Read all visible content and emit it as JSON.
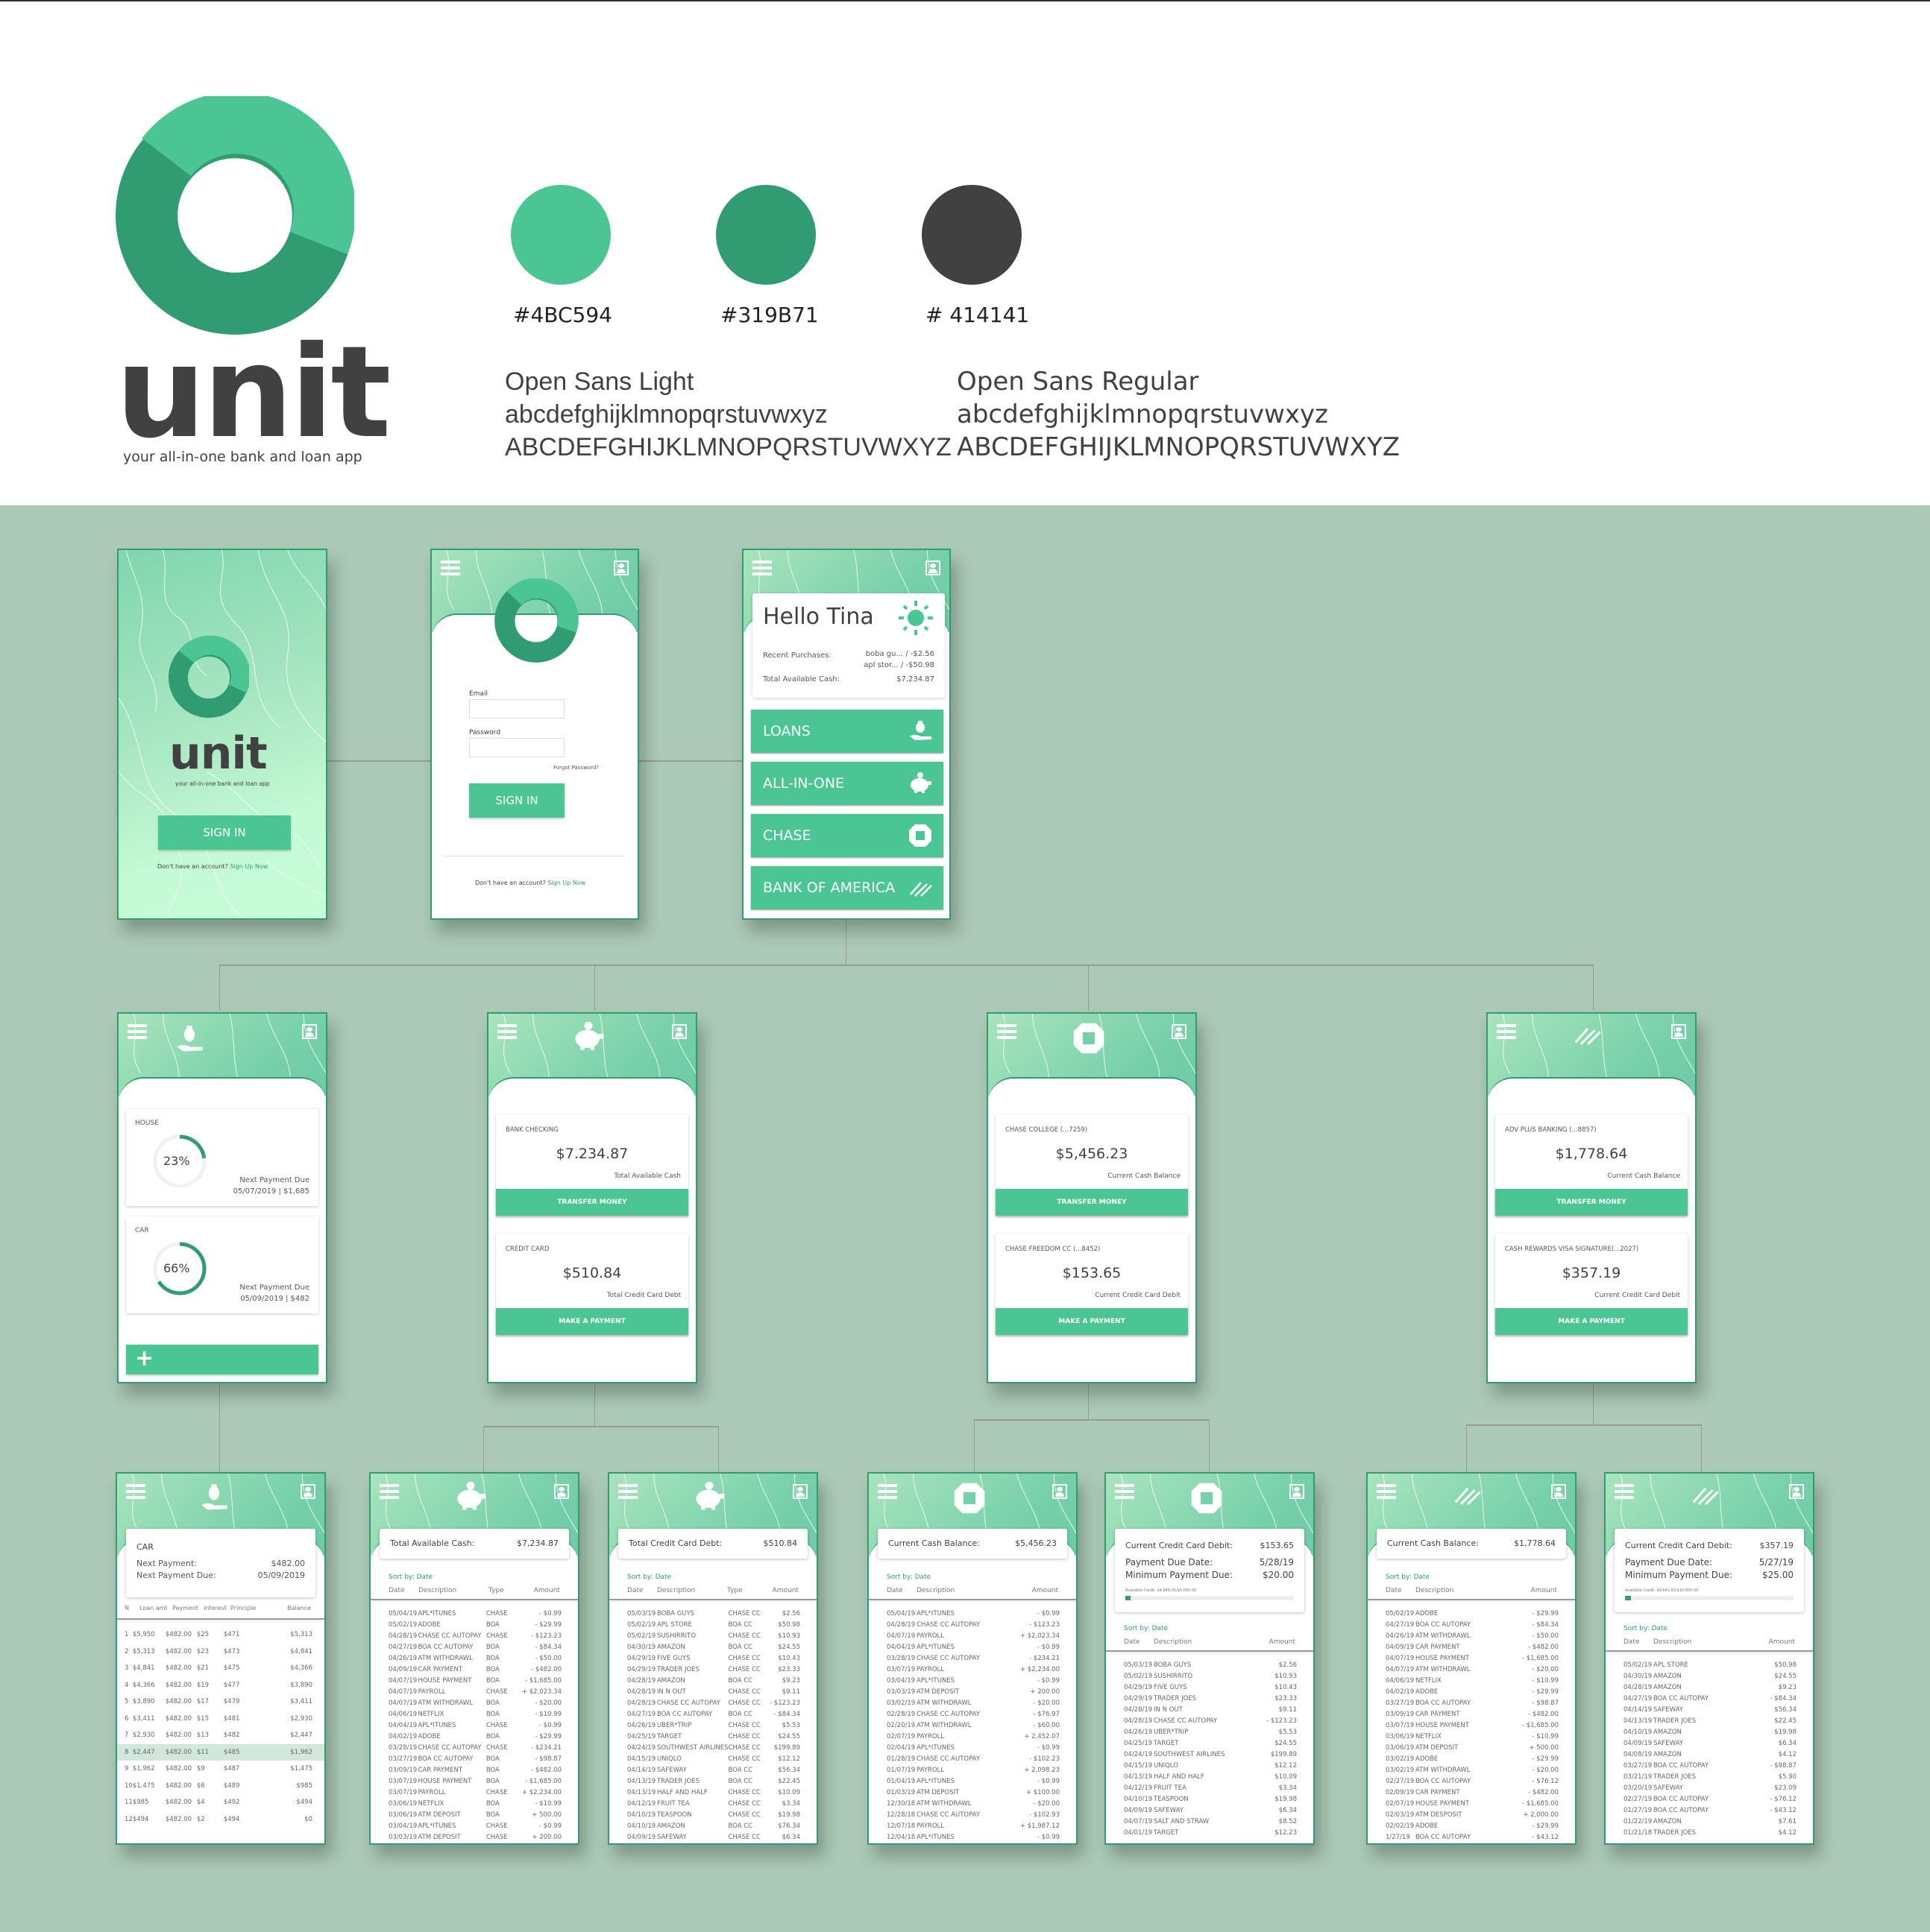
{
  "brand": {
    "wordmark": "unit",
    "tagline": "your all-in-one bank and loan app",
    "colors": [
      {
        "hex": "#4BC594",
        "label": "#4BC594"
      },
      {
        "hex": "#319B71",
        "label": "#319B71"
      },
      {
        "hex": "#414141",
        "label": "# 414141"
      }
    ],
    "fonts": [
      {
        "name": "Open Sans Light",
        "lower": "abcdefghijklmnopqrstuvwxyz",
        "upper": "ABCDEFGHIJKLMNOPQRSTUVWXYZ"
      },
      {
        "name": "Open Sans Regular",
        "lower": "abcdefghijklmnopqrstuvwxyz",
        "upper": "ABCDEFGHIJKLMNOPQRSTUVWXYZ"
      }
    ]
  },
  "splash": {
    "wordmark": "unit",
    "tagline": "your all-in-one bank and loan app",
    "sign_in": "SIGN IN",
    "no_account": "Don't have an account?",
    "sign_up": "Sign Up Now"
  },
  "login": {
    "email_label": "Email",
    "email_value": "",
    "password_label": "Password",
    "password_value": "",
    "forgot": "Forgot Password?",
    "sign_in": "SIGN IN",
    "no_account": "Don't have an account?",
    "sign_up": "Sign Up Now"
  },
  "home": {
    "greeting": "Hello Tina",
    "recent_label": "Recent Purchases:",
    "recent": [
      "boba gu... / -$2.56",
      "apl stor... / -$50.98"
    ],
    "cash_label": "Total Available Cash:",
    "cash_value": "$7,234.87",
    "buttons": [
      "LOANS",
      "ALL-IN-ONE",
      "CHASE",
      "BANK OF AMERICA"
    ]
  },
  "loans": {
    "items": [
      {
        "name": "HOUSE",
        "percent": 23,
        "percent_label": "23%",
        "next_label": "Next Payment Due",
        "next_value": "05/07/2019 | $1,685"
      },
      {
        "name": "CAR",
        "percent": 66,
        "percent_label": "66%",
        "next_label": "Next Payment Due",
        "next_value": "05/09/2019 | $482"
      }
    ],
    "add_label": "+"
  },
  "all_in_one": {
    "accounts": [
      {
        "name": "BANK CHECKING",
        "amount": "$7.234.87",
        "caption": "Total Available Cash",
        "action": "TRANSFER MONEY"
      },
      {
        "name": "CREDIT CARD",
        "amount": "$510.84",
        "caption": "Total Credit Card Debt",
        "action": "MAKE A PAYMENT"
      }
    ]
  },
  "chase": {
    "accounts": [
      {
        "name": "CHASE COLLEGE (...7259)",
        "amount": "$5,456.23",
        "caption": "Current Cash Balance",
        "action": "TRANSFER MONEY"
      },
      {
        "name": "CHASE FREEDOM CC (...8452)",
        "amount": "$153.65",
        "caption": "Current Credit Card Debit",
        "action": "MAKE A PAYMENT"
      }
    ]
  },
  "boa": {
    "accounts": [
      {
        "name": "ADV PLUS BANKING (...8857)",
        "amount": "$1,778.64",
        "caption": "Current Cash Balance",
        "action": "TRANSFER MONEY"
      },
      {
        "name": "CASH REWARDS VISA SIGNATURE(...2027)",
        "amount": "$357.19",
        "caption": "Current Credit Card Debit",
        "action": "MAKE A PAYMENT"
      }
    ]
  },
  "car_loan": {
    "title": "CAR",
    "next_payment_label": "Next Payment:",
    "next_payment_value": "$482.00",
    "next_due_label": "Next Payment Due:",
    "next_due_value": "05/09/2019",
    "columns": [
      "N",
      "Loan amt",
      "Payment",
      "Interest",
      "Principle",
      "Balance"
    ],
    "highlighted_row": 8,
    "rows": [
      [
        "1",
        "$5,950",
        "$482.00",
        "$25",
        "$471",
        "$5,313"
      ],
      [
        "2",
        "$5,313",
        "$482.00",
        "$23",
        "$473",
        "$4,841"
      ],
      [
        "3",
        "$4,841",
        "$482.00",
        "$21",
        "$475",
        "$4,366"
      ],
      [
        "4",
        "$4,366",
        "$482.00",
        "$19",
        "$477",
        "$3,890"
      ],
      [
        "5",
        "$3,890",
        "$482.00",
        "$17",
        "$479",
        "$3,411"
      ],
      [
        "6",
        "$3,411",
        "$482.00",
        "$15",
        "$481",
        "$2,930"
      ],
      [
        "7",
        "$2,930",
        "$482.00",
        "$13",
        "$482",
        "$2,447"
      ],
      [
        "8",
        "$2,447",
        "$482.00",
        "$11",
        "$485",
        "$1,962"
      ],
      [
        "9",
        "$1,962",
        "$482.00",
        "$9",
        "$487",
        "$1,475"
      ],
      [
        "10",
        "$1,475",
        "$482.00",
        "$6",
        "$489",
        "$985"
      ],
      [
        "11",
        "$985",
        "$482.00",
        "$4",
        "$492",
        "$494"
      ],
      [
        "12",
        "$494",
        "$482.00",
        "$2",
        "$494",
        "$0"
      ]
    ]
  },
  "ledgers": [
    {
      "id": "aio-cash",
      "summary": [
        [
          "Total Available Cash:",
          "$7,234.87"
        ]
      ],
      "sort": "Sort by: Date",
      "columns": [
        "Date",
        "Description",
        "Type",
        "Amount"
      ],
      "rows": [
        [
          "05/04/19",
          "APL*ITUNES",
          "CHASE",
          "- $0.99"
        ],
        [
          "05/02/19",
          "ADOBE",
          "BOA",
          "- $29.99"
        ],
        [
          "04/28/19",
          "CHASE CC AUTOPAY",
          "CHASE",
          "- $123.23"
        ],
        [
          "04/27/19",
          "BOA CC AUTOPAY",
          "BOA",
          "- $84.34"
        ],
        [
          "04/26/19",
          "ATM WITHDRAWL",
          "BOA",
          "- $50.00"
        ],
        [
          "04/09/19",
          "CAR PAYMENT",
          "BOA",
          "- $482.00"
        ],
        [
          "04/07/19",
          "HOUSE PAYMENT",
          "BOA",
          "- $1,685.00"
        ],
        [
          "04/07/19",
          "PAYROLL",
          "CHASE",
          "+ $2,023.34"
        ],
        [
          "04/07/19",
          "ATM WITHDRAWL",
          "BOA",
          "- $20.00"
        ],
        [
          "04/06/19",
          "NETFLIX",
          "BOA",
          "- $10.99"
        ],
        [
          "04/04/19",
          "APL*ITUNES",
          "CHASE",
          "- $0.99"
        ],
        [
          "04/02/19",
          "ADOBE",
          "BOA",
          "- $29.99"
        ],
        [
          "03/28/19",
          "CHASE CC AUTOPAY",
          "CHASE",
          "- $234.21"
        ],
        [
          "03/27/19",
          "BOA CC AUTOPAY",
          "BOA",
          "- $98.87"
        ],
        [
          "03/09/19",
          "CAR PAYMENT",
          "BOA",
          "- $482.00"
        ],
        [
          "03/07/19",
          "HOUSE PAYMENT",
          "BOA",
          "- $1,685.00"
        ],
        [
          "03/07/19",
          "PAYROLL",
          "CHASE",
          "+ $2,234.00"
        ],
        [
          "03/06/19",
          "NETFLIX",
          "BOA",
          "- $10.99"
        ],
        [
          "03/06/19",
          "ATM DEPOSIT",
          "BOA",
          "+ 500.00"
        ],
        [
          "03/04/19",
          "APL*ITUNES",
          "CHASE",
          "- $0.99"
        ],
        [
          "03/03/19",
          "ATM DEPOSIT",
          "CHASE",
          "+ 200.00"
        ]
      ]
    },
    {
      "id": "aio-credit",
      "summary": [
        [
          "Total Credit Card Debt:",
          "$510.84"
        ]
      ],
      "sort": "Sort by: Date",
      "columns": [
        "Date",
        "Description",
        "Type",
        "Amount"
      ],
      "rows": [
        [
          "05/03/19",
          "BOBA GUYS",
          "CHASE CC",
          "$2.56"
        ],
        [
          "05/02/19",
          "APL STORE",
          "BOA CC",
          "$50.98"
        ],
        [
          "05/02/19",
          "SUSHIRRITO",
          "CHASE CC",
          "$10.93"
        ],
        [
          "04/30/19",
          "AMAZON",
          "BOA CC",
          "$24.55"
        ],
        [
          "04/29/19",
          "FIVE GUYS",
          "CHASE CC",
          "$10.43"
        ],
        [
          "04/29/19",
          "TRADER JOES",
          "CHASE CC",
          "$23.33"
        ],
        [
          "04/28/19",
          "AMAZON",
          "BOA CC",
          "$9.23"
        ],
        [
          "04/28/19",
          "IN N OUT",
          "CHASE CC",
          "$9.11"
        ],
        [
          "04/28/19",
          "CHASE CC AUTOPAY",
          "CHASE CC",
          "- $123.23"
        ],
        [
          "04/27/19",
          "BOA CC AUTOPAY",
          "BOA CC",
          "- $84.34"
        ],
        [
          "04/26/19",
          "UBER*TRIP",
          "CHASE CC",
          "$5.53"
        ],
        [
          "04/25/19",
          "TARGET",
          "CHASE CC",
          "$24.55"
        ],
        [
          "04/24/19",
          "SOUTHWEST AIRLINES",
          "CHASE CC",
          "$199.89"
        ],
        [
          "04/15/19",
          "UNIQLO",
          "CHASE CC",
          "$12.12"
        ],
        [
          "04/14/19",
          "SAFEWAY",
          "BOA CC",
          "$56.34"
        ],
        [
          "04/13/19",
          "TRADER JOES",
          "BOA CC",
          "$22.45"
        ],
        [
          "04/13/19",
          "HALF AND HALF",
          "CHASE CC",
          "$10.09"
        ],
        [
          "04/12/19",
          "FRUIT TEA",
          "CHASE CC",
          "$3.34"
        ],
        [
          "04/10/19",
          "TEASPOON",
          "CHASE CC",
          "$19.98"
        ],
        [
          "04/10/19",
          "AMAZON",
          "BOA CC",
          "$76.34"
        ],
        [
          "04/09/19",
          "SAFEWAY",
          "CHASE CC",
          "$6.34"
        ]
      ]
    },
    {
      "id": "chase-cash",
      "summary": [
        [
          "Current Cash Balance:",
          "$5,456.23"
        ]
      ],
      "sort": "Sort by: Date",
      "columns": [
        "Date",
        "Description",
        "Amount"
      ],
      "rows": [
        [
          "05/04/19",
          "APL*ITUNES",
          "- $0.99"
        ],
        [
          "04/28/19",
          "CHASE CC AUTOPAY",
          "- $123.23"
        ],
        [
          "04/07/19",
          "PAYROLL",
          "+ $2,023.34"
        ],
        [
          "04/04/19",
          "APL*ITUNES",
          "- $0.99"
        ],
        [
          "03/28/19",
          "CHASE CC AUTOPAY",
          "- $234.21"
        ],
        [
          "03/07/19",
          "PAYROLL",
          "+ $2,234.00"
        ],
        [
          "03/04/19",
          "APL*ITUNES",
          "- $0.99"
        ],
        [
          "03/03/19",
          "ATM DEPOSIT",
          "+ 200.00"
        ],
        [
          "03/02/19",
          "ATM WITHDRAWL",
          "- $20.00"
        ],
        [
          "02/28/19",
          "CHASE CC AUTOPAY",
          "- $76.97"
        ],
        [
          "02/20/19",
          "ATM WITHDRAWL",
          "- $60.00"
        ],
        [
          "02/07/19",
          "PAYROLL",
          "+ 2,452.07"
        ],
        [
          "02/04/19",
          "APL*ITUNES",
          "- $0.99"
        ],
        [
          "01/28/19",
          "CHASE CC AUTOPAY",
          "- $102.23"
        ],
        [
          "01/07/19",
          "PAYROLL",
          "+ 2,098.23"
        ],
        [
          "01/04/19",
          "APL*ITUNES",
          "- $0.99"
        ],
        [
          "01/03/19",
          "ATM DEPOSIT",
          "+ $100.00"
        ],
        [
          "12/30/18",
          "ATM WITHDRAWL",
          "- $20.00"
        ],
        [
          "12/28/18",
          "CHASE CC AUTOPAY",
          "- $102.93"
        ],
        [
          "12/07/18",
          "PAYROLL",
          "+ $1,987.12"
        ],
        [
          "12/04/18",
          "APL*ITUNES",
          "- $0.99"
        ]
      ]
    },
    {
      "id": "chase-credit",
      "summary": [
        [
          "Current Credit Card Debit:",
          "$153.65"
        ],
        [
          "Payment Due Date:",
          "5/28/19"
        ],
        [
          "Minimum Payment Due:",
          "$20.00"
        ]
      ],
      "available_credit": "Available Credit: $4,846.35/$5,000.00",
      "credit_used_fraction": 0.031,
      "sort": "Sort by: Date",
      "columns": [
        "Date",
        "Description",
        "Amount"
      ],
      "rows": [
        [
          "05/03/19",
          "BOBA GUYS",
          "$2.56"
        ],
        [
          "05/02/19",
          "SUSHIRRITO",
          "$10.93"
        ],
        [
          "04/29/19",
          "FIVE GUYS",
          "$10.43"
        ],
        [
          "04/29/19",
          "TRADER JOES",
          "$23.33"
        ],
        [
          "04/28/19",
          "IN N OUT",
          "$9.11"
        ],
        [
          "04/28/19",
          "CHASE CC AUTOPAY",
          "- $123.23"
        ],
        [
          "04/26/19",
          "UBER*TRIP",
          "$5.53"
        ],
        [
          "04/25/19",
          "TARGET",
          "$24.55"
        ],
        [
          "04/24/19",
          "SOUTHWEST AIRLINES",
          "$199.89"
        ],
        [
          "04/15/19",
          "UNIQLO",
          "$12.12"
        ],
        [
          "04/13/19",
          "HALF AND HALF",
          "$10.09"
        ],
        [
          "04/12/19",
          "FRUIT TEA",
          "$3.34"
        ],
        [
          "04/10/19",
          "TEASPOON",
          "$19.98"
        ],
        [
          "04/09/19",
          "SAFEWAY",
          "$6.34"
        ],
        [
          "04/07/19",
          "SALT AND STRAW",
          "$8.52"
        ],
        [
          "04/01/19",
          "TARGET",
          "$12.23"
        ]
      ]
    },
    {
      "id": "boa-cash",
      "summary": [
        [
          "Current Cash Balance:",
          "$1,778.64"
        ]
      ],
      "sort": "Sort by: Date",
      "columns": [
        "Date",
        "Description",
        "Amount"
      ],
      "rows": [
        [
          "05/02/19",
          "ADOBE",
          "- $29.99"
        ],
        [
          "04/27/19",
          "BOA CC AUTOPAY",
          "- $84.34"
        ],
        [
          "04/26/19",
          "ATM WITHDRAWL",
          "- $50.00"
        ],
        [
          "04/09/19",
          "CAR PAYMENT",
          "- $482.00"
        ],
        [
          "04/07/19",
          "HOUSE PAYMENT",
          "- $1,685.00"
        ],
        [
          "04/07/19",
          "ATM WITHDRAWL",
          "- $20.00"
        ],
        [
          "04/06/19",
          "NETFLIX",
          "- $10.99"
        ],
        [
          "04/02/19",
          "ADOBE",
          "- $29.99"
        ],
        [
          "03/27/19",
          "BOA CC AUTOPAY",
          "- $98.87"
        ],
        [
          "03/09/19",
          "CAR PAYMENT",
          "- $482.00"
        ],
        [
          "03/07/19",
          "HOUSE PAYMENT",
          "- $1,685.00"
        ],
        [
          "03/06/19",
          "NETFLIX",
          "- $10.99"
        ],
        [
          "03/06/19",
          "ATM DEPOSIT",
          "+ 500.00"
        ],
        [
          "03/02/19",
          "ADOBE",
          "- $29.99"
        ],
        [
          "03/02/19",
          "ATM WITHDRAWL",
          "- $20.00"
        ],
        [
          "02/27/19",
          "BOA CC AUTOPAY",
          "- $76.12"
        ],
        [
          "02/09/19",
          "CAR PAYMENT",
          "- $482.00"
        ],
        [
          "02/07/19",
          "HOUSE PAYMENT",
          "- $1,685.00"
        ],
        [
          "02/03/19",
          "ATM DESPOSIT",
          "+ 2,000.00"
        ],
        [
          "02/02/19",
          "ADOBE",
          "- $29.99"
        ],
        [
          "1/27/19",
          "BOA CC AUTOPAY",
          "- $43.12"
        ]
      ]
    },
    {
      "id": "boa-credit",
      "summary": [
        [
          "Current Credit Card Debit:",
          "$357.19"
        ],
        [
          "Payment Due Date:",
          "5/27/19"
        ],
        [
          "Minimum Payment Due:",
          "$25.00"
        ]
      ],
      "available_credit": "Available Credit: $9,642.81/$10,000.00",
      "credit_used_fraction": 0.036,
      "sort": "Sort by: Date",
      "columns": [
        "Date",
        "Description",
        "Amount"
      ],
      "rows": [
        [
          "05/02/19",
          "APL STORE",
          "$50.98"
        ],
        [
          "04/30/19",
          "AMAZON",
          "$24.55"
        ],
        [
          "04/28/19",
          "AMAZON",
          "$9.23"
        ],
        [
          "04/27/19",
          "BOA CC AUTOPAY",
          "- $84.34"
        ],
        [
          "04/14/19",
          "SAFEWAY",
          "$56.34"
        ],
        [
          "04/13/19",
          "TRADER JOES",
          "$22.45"
        ],
        [
          "04/10/19",
          "AMAZON",
          "$19.98"
        ],
        [
          "04/09/19",
          "SAFEWAY",
          "$6.34"
        ],
        [
          "04/08/19",
          "AMAZON",
          "$4.12"
        ],
        [
          "03/27/19",
          "BOA CC AUTOPAY",
          "- $98.87"
        ],
        [
          "03/21/19",
          "TRADER JOES",
          "$5.90"
        ],
        [
          "03/20/19",
          "SAFEWAY",
          "$23.09"
        ],
        [
          "02/27/19",
          "BOA CC AUTOPAY",
          "- $76.12"
        ],
        [
          "01/27/19",
          "BOA CC AUTOPAY",
          "- $43.12"
        ],
        [
          "01/22/19",
          "AMAZON",
          "$7.61"
        ],
        [
          "01/21/18",
          "TRADER JOES",
          "$4.12"
        ]
      ]
    }
  ]
}
